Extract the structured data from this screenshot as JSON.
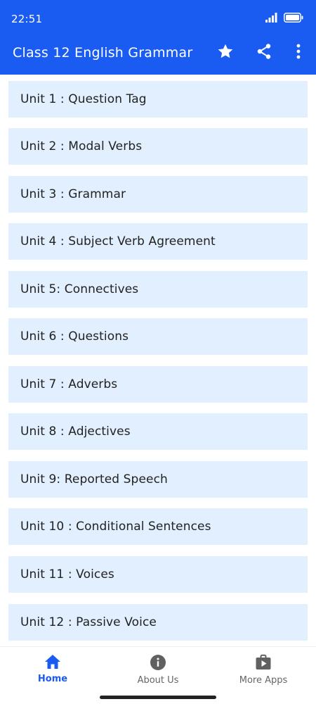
{
  "status": {
    "time": "22:51",
    "icons": [
      "signal-icon",
      "battery-icon"
    ]
  },
  "appbar": {
    "title": "Class 12 English Grammar",
    "actions": [
      "star-icon",
      "share-icon",
      "more-vert-icon"
    ]
  },
  "units": [
    {
      "label": "Unit 1 : Question Tag"
    },
    {
      "label": "Unit 2 : Modal Verbs"
    },
    {
      "label": "Unit 3 : Grammar"
    },
    {
      "label": "Unit 4 : Subject Verb Agreement"
    },
    {
      "label": "Unit 5: Connectives"
    },
    {
      "label": "Unit 6 : Questions"
    },
    {
      "label": "Unit 7 : Adverbs"
    },
    {
      "label": "Unit 8 : Adjectives"
    },
    {
      "label": "Unit 9: Reported Speech"
    },
    {
      "label": "Unit 10 : Conditional Sentences"
    },
    {
      "label": "Unit 11 : Voices"
    },
    {
      "label": "Unit 12 : Passive Voice"
    }
  ],
  "bottom_nav": {
    "items": [
      {
        "label": "Home",
        "icon": "home-icon",
        "active": true
      },
      {
        "label": "About Us",
        "icon": "info-icon",
        "active": false
      },
      {
        "label": "More Apps",
        "icon": "play-store-icon",
        "active": false
      }
    ]
  },
  "colors": {
    "primary": "#1a5cf2",
    "list_item_bg": "#e2efff",
    "inactive_nav": "#666666"
  }
}
